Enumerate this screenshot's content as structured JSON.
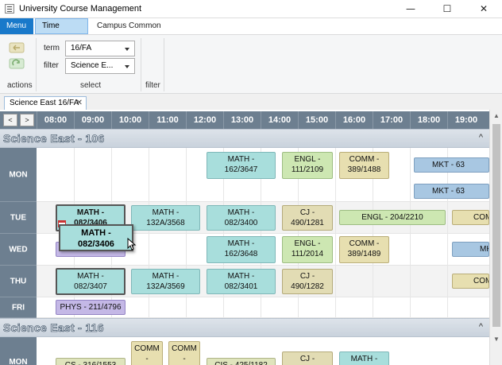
{
  "window": {
    "title": "University Course Management",
    "minimize_glyph": "—",
    "maximize_glyph": "☐",
    "close_glyph": "✕"
  },
  "ribbon_tabs": [
    "Menu",
    "Time Graphs",
    "Campus Common"
  ],
  "ribbon": {
    "groups": {
      "actions": "actions",
      "select": "select",
      "filter": "filter"
    },
    "term_label": "term",
    "term_value": "16/FA",
    "filter_label": "filter",
    "filter_value": "Science E..."
  },
  "document_tab": {
    "label": "Science East 16/FA",
    "close": "✕"
  },
  "nav": {
    "prev": "<",
    "next": ">"
  },
  "times": [
    "08:00",
    "09:00",
    "10:00",
    "11:00",
    "12:00",
    "13:00",
    "14:00",
    "15:00",
    "16:00",
    "17:00",
    "18:00",
    "19:00"
  ],
  "rooms": [
    {
      "title": "Science East - 106",
      "collapse": "^",
      "days": [
        "MON",
        "TUE",
        "WED",
        "THU",
        "FRI"
      ],
      "courses": {
        "mon_math": [
          "MATH -",
          "162/3647"
        ],
        "mon_engl": [
          "ENGL -",
          "111/2109"
        ],
        "mon_comm": [
          "COMM -",
          "389/1488"
        ],
        "mon_mkt1": "MKT - 63",
        "mon_mkt2": "MKT - 63",
        "tue_math_sel": [
          "MATH -",
          "082/3406"
        ],
        "tue_math1": [
          "MATH -",
          "132A/3568"
        ],
        "tue_math2": [
          "MATH -",
          "082/3400"
        ],
        "tue_cj": [
          "CJ -",
          "490/1281"
        ],
        "tue_engl": "ENGL - 204/2210",
        "tue_comm": "COM",
        "wed_phys": "PHYS - 211/4795",
        "wed_math": [
          "MATH -",
          "162/3648"
        ],
        "wed_engl": [
          "ENGL -",
          "111/2014"
        ],
        "wed_comm": [
          "COMM -",
          "389/1489"
        ],
        "wed_mk": "MK",
        "thu_math_sel": [
          "MATH -",
          "082/3407"
        ],
        "thu_math1": [
          "MATH -",
          "132A/3569"
        ],
        "thu_math2": [
          "MATH -",
          "082/3401"
        ],
        "thu_cj": [
          "CJ -",
          "490/1282"
        ],
        "thu_com": "COM",
        "fri_phys": "PHYS - 211/4796"
      }
    },
    {
      "title": "Science East - 116",
      "collapse": "^",
      "days": [
        "MON"
      ],
      "courses": {
        "cs": "CS - 316/1553",
        "comm1": [
          "COMM",
          "-"
        ],
        "comm2": [
          "COMM",
          "-"
        ],
        "cis": "CIS - 425/1182",
        "cj": "CJ -",
        "math": "MATH -"
      }
    }
  ],
  "drag_tooltip": [
    "MATH -",
    "082/3406"
  ],
  "colors": {
    "accent": "#1979ca",
    "header": "#6d7f90",
    "math": "#a8dedc",
    "engl": "#cde7b2",
    "comm": "#e7dfb0",
    "mkt": "#a8c7e2",
    "phys": "#c4b8e6"
  },
  "scrollbar": {
    "up": "▲",
    "down": "▼"
  }
}
